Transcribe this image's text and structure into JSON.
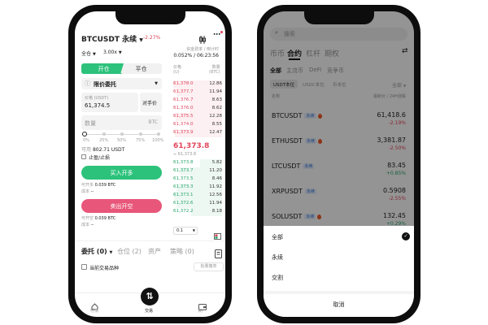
{
  "colors": {
    "buy": "#2cc27b",
    "sell": "#e8577a",
    "up": "#27a56b",
    "down": "#e0445a",
    "brand": "#222222"
  },
  "left": {
    "symbol": "BTCUSDT 永续",
    "change": "-2.27%",
    "mode": "全仓",
    "leverage": "3.00x",
    "funding_label": "资金费率 / 倒计时",
    "funding_value": "0.052% / 06:23:56",
    "tab_open": "开仓",
    "tab_close": "平仓",
    "order_type": "限价委托",
    "price_label": "价格 (USDT)",
    "price_value": "61,374.5",
    "opponent_label": "对手价",
    "qty_placeholder": "数量",
    "qty_unit": "BTC",
    "slider_marks": [
      "0%",
      "25%",
      "50%",
      "75%",
      "100%"
    ],
    "available_label": "可用",
    "available_value": "802.71 USDT",
    "tpsl_label": "止盈/止损",
    "buy_label": "买入开多",
    "sell_label": "卖出开空",
    "can_open_label": "可开多",
    "can_open_value": "0.039 BTC",
    "cost_label": "成本",
    "cost_value": "--",
    "can_short_label": "可开空",
    "can_short_value": "0.039 BTC",
    "cost2_label": "成本",
    "cost2_value": "--",
    "ob_header_price": "价格",
    "ob_header_price_unit": "(U)",
    "ob_header_qty": "数量",
    "ob_header_qty_unit": "(BTC)",
    "asks": [
      {
        "price": "61,378.0",
        "qty": "12.86"
      },
      {
        "price": "61,377.7",
        "qty": "11.94"
      },
      {
        "price": "61,376.7",
        "qty": "8.63"
      },
      {
        "price": "61,376.0",
        "qty": "8.62"
      },
      {
        "price": "61,375.5",
        "qty": "12.28"
      },
      {
        "price": "61,374.0",
        "qty": "8.55"
      },
      {
        "price": "61,373.9",
        "qty": "12.47"
      }
    ],
    "last_price": "61,373.8",
    "mark_price": "≈ 61,373.8",
    "bids": [
      {
        "price": "61,373.8",
        "qty": "5.82"
      },
      {
        "price": "61,373.7",
        "qty": "11.20"
      },
      {
        "price": "61,373.5",
        "qty": "8.46"
      },
      {
        "price": "61,373.3",
        "qty": "11.92"
      },
      {
        "price": "61,373.1",
        "qty": "12.56"
      },
      {
        "price": "61,372.6",
        "qty": "11.94"
      },
      {
        "price": "61,372.2",
        "qty": "8.18"
      }
    ],
    "precision": "0.1",
    "bottom_tabs": [
      "委托 (0)",
      "仓位 (2)",
      "资产",
      "策略 (0)"
    ],
    "current_only": "当前交易品种",
    "cancel_all": "批量撤单",
    "nav": [
      "行情",
      "交易",
      "资产"
    ]
  },
  "right": {
    "search_placeholder": "搜索",
    "top_tabs": [
      "币币",
      "合约",
      "杠杆",
      "期权"
    ],
    "sub_tabs": [
      "全部",
      "主流币",
      "DeFi",
      "竞争币"
    ],
    "filter_tabs": [
      "USDT本位",
      "USDC本位",
      "币本位"
    ],
    "filter_all": "全部",
    "col_name": "名称",
    "col_price": "最新价 / 24H涨跌",
    "tag": "永续",
    "markets": [
      {
        "name": "BTCUSDT",
        "hot": true,
        "price": "61,418.6",
        "change": "-2.19%",
        "dir": "down"
      },
      {
        "name": "ETHUSDT",
        "hot": true,
        "price": "3,381.87",
        "change": "-2.50%",
        "dir": "down"
      },
      {
        "name": "LTCUSDT",
        "hot": false,
        "price": "83.45",
        "change": "+0.85%",
        "dir": "up"
      },
      {
        "name": "XRPUSDT",
        "hot": false,
        "price": "0.5908",
        "change": "-2.55%",
        "dir": "down"
      },
      {
        "name": "SOLUSDT",
        "hot": true,
        "price": "132.45",
        "change": "+0.29%",
        "dir": "up"
      }
    ],
    "sheet_options": [
      "全部",
      "永续",
      "交割"
    ],
    "sheet_selected": "全部",
    "sheet_cancel": "取消"
  }
}
